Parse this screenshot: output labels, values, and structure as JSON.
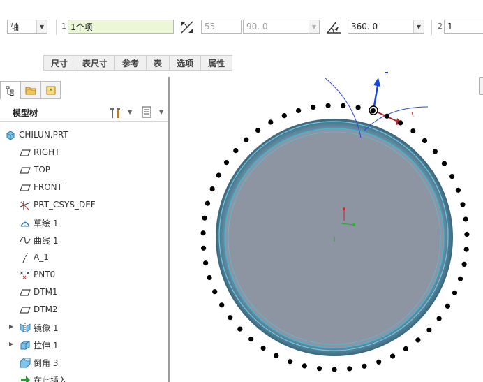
{
  "dashboard": {
    "reference_type": "轴",
    "collector1_number": "1",
    "collector1_value": "1个项",
    "count_value": "55",
    "increment_value": "90. 0",
    "angle_value": "360. 0",
    "collector2_number": "2",
    "collector2_value": "1",
    "tabs": [
      "尺寸",
      "表尺寸",
      "参考",
      "表",
      "选项",
      "属性"
    ]
  },
  "model_tree": {
    "title": "模型树",
    "items": [
      {
        "label": "CHILUN.PRT",
        "icon": "part-icon"
      },
      {
        "label": "RIGHT",
        "icon": "datum-plane-icon"
      },
      {
        "label": "TOP",
        "icon": "datum-plane-icon"
      },
      {
        "label": "FRONT",
        "icon": "datum-plane-icon"
      },
      {
        "label": "PRT_CSYS_DEF",
        "icon": "coordinate-system-icon"
      },
      {
        "label": "草绘 1",
        "icon": "sketch-icon"
      },
      {
        "label": "曲线 1",
        "icon": "curve-icon"
      },
      {
        "label": "A_1",
        "icon": "datum-axis-icon"
      },
      {
        "label": "PNT0",
        "icon": "datum-point-icon"
      },
      {
        "label": "DTM1",
        "icon": "datum-plane-icon"
      },
      {
        "label": "DTM2",
        "icon": "datum-plane-icon"
      },
      {
        "label": "镜像 1",
        "icon": "mirror-icon"
      },
      {
        "label": "拉伸 1",
        "icon": "extrude-icon"
      },
      {
        "label": "倒角 3",
        "icon": "chamfer-icon"
      },
      {
        "label": "在此插入",
        "icon": "insert-arrow-icon"
      }
    ]
  },
  "graphics": {
    "pattern_point_count": 55,
    "colors": {
      "disc_fill": "#8c95a1",
      "rim": "#5c8ea4",
      "edge": "#3fb8d8",
      "dot": "#000000",
      "drag_arrow": "#1446d8",
      "dim_arrow": "#b8222a"
    }
  }
}
